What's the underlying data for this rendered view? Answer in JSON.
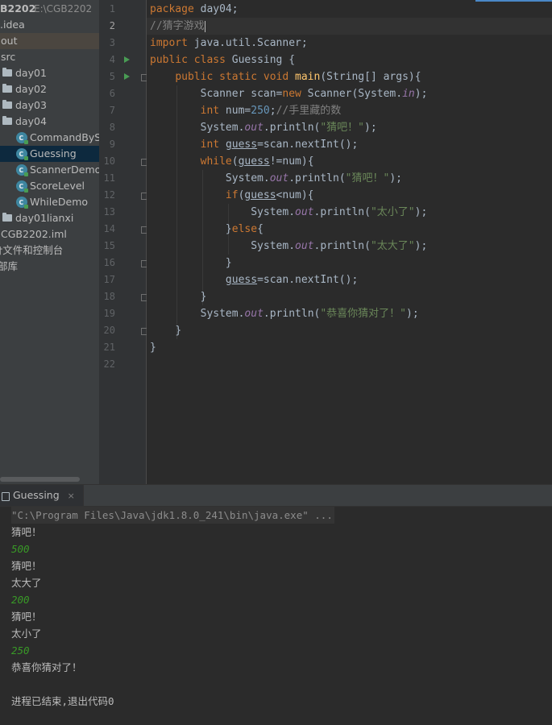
{
  "project_tree": {
    "project_name": "B2202",
    "project_path": "E:\\CGB2202",
    "items": [
      {
        "label": ".idea",
        "kind": "folder"
      },
      {
        "label": "out",
        "kind": "folder"
      },
      {
        "label": "src",
        "kind": "folder"
      },
      {
        "label": "day01",
        "kind": "folder"
      },
      {
        "label": "day02",
        "kind": "folder"
      },
      {
        "label": "day03",
        "kind": "folder"
      },
      {
        "label": "day04",
        "kind": "folder"
      },
      {
        "label": "CommandBySw",
        "kind": "class"
      },
      {
        "label": "Guessing",
        "kind": "class"
      },
      {
        "label": "ScannerDemo",
        "kind": "class"
      },
      {
        "label": "ScoreLevel",
        "kind": "class"
      },
      {
        "label": "WhileDemo",
        "kind": "class"
      },
      {
        "label": "day01lianxi",
        "kind": "module"
      },
      {
        "label": "CGB2202.iml",
        "kind": "file"
      },
      {
        "label": "†文件和控制台",
        "kind": "node"
      },
      {
        "label": "部库",
        "kind": "node"
      }
    ]
  },
  "editor": {
    "current_line": "2",
    "line_numbers": [
      "1",
      "2",
      "3",
      "4",
      "5",
      "6",
      "7",
      "8",
      "9",
      "10",
      "11",
      "12",
      "13",
      "14",
      "15",
      "16",
      "17",
      "18",
      "19",
      "20",
      "21",
      "22"
    ],
    "code": {
      "l1_package": "package",
      "l1_name": " day04;",
      "l2_comment": "//猜字游戏",
      "l3_import": "import",
      "l3_name": " java.util.Scanner;",
      "l4_public": "public",
      "l4_class": " class",
      "l4_name": " Guessing {",
      "l5_mods": "public static void",
      "l5_main": "main",
      "l5_args": "(String[] args){",
      "l6_a": "Scanner scan=",
      "l6_new": "new",
      "l6_b": " Scanner(System.",
      "l6_in": "in",
      "l6_c": ");",
      "l7_int": "int",
      "l7_a": " num=",
      "l7_num": "250",
      "l7_b": ";",
      "l7_comment": "//手里藏的数",
      "l8_a": "System.",
      "l8_out": "out",
      "l8_b": ".println(",
      "l8_str": "\"猜吧！\"",
      "l8_c": ");",
      "l9_int": "int",
      "l9_sp": " ",
      "l9_guess": "guess",
      "l9_rest": "=scan.nextInt();",
      "l10_while": "while",
      "l10_a": "(",
      "l10_guess": "guess",
      "l10_b": "!=num){",
      "l11_a": "System.",
      "l11_out": "out",
      "l11_b": ".println(",
      "l11_str": "\"猜吧！\"",
      "l11_c": ");",
      "l12_if": "if",
      "l12_a": "(",
      "l12_guess": "guess",
      "l12_b": "<num){",
      "l13_a": "System.",
      "l13_out": "out",
      "l13_b": ".println(",
      "l13_str": "\"太小了\"",
      "l13_c": ");",
      "l14_a": "}",
      "l14_else": "else",
      "l14_b": "{",
      "l15_a": "System.",
      "l15_out": "out",
      "l15_b": ".println(",
      "l15_str": "\"太大了\"",
      "l15_c": ");",
      "l16": "}",
      "l17_guess": "guess",
      "l17_rest": "=scan.nextInt();",
      "l18": "}",
      "l19_a": "System.",
      "l19_out": "out",
      "l19_b": ".println(",
      "l19_str": "\"恭喜你猜对了！\"",
      "l19_c": ");",
      "l20": "}",
      "l21": "}"
    }
  },
  "run_panel": {
    "tab_label": "Guessing",
    "close_glyph": "×",
    "console_lines": [
      {
        "text": "\"C:\\Program Files\\Java\\jdk1.8.0_241\\bin\\java.exe\" ...",
        "type": "cmd"
      },
      {
        "text": "猜吧！",
        "type": "out"
      },
      {
        "text": "500",
        "type": "input"
      },
      {
        "text": "猜吧！",
        "type": "out"
      },
      {
        "text": "太大了",
        "type": "out"
      },
      {
        "text": "200",
        "type": "input"
      },
      {
        "text": "猜吧！",
        "type": "out"
      },
      {
        "text": "太小了",
        "type": "out"
      },
      {
        "text": "250",
        "type": "input"
      },
      {
        "text": "恭喜你猜对了！",
        "type": "out"
      },
      {
        "text": "",
        "type": "out"
      },
      {
        "text": "进程已结束,退出代码0",
        "type": "out"
      }
    ]
  },
  "colors": {
    "keyword": "#cc7832",
    "string": "#6a8759",
    "number": "#6897bb",
    "method": "#ffc66d",
    "static_field": "#9876aa",
    "comment": "#808080",
    "console_input": "#399b27"
  }
}
